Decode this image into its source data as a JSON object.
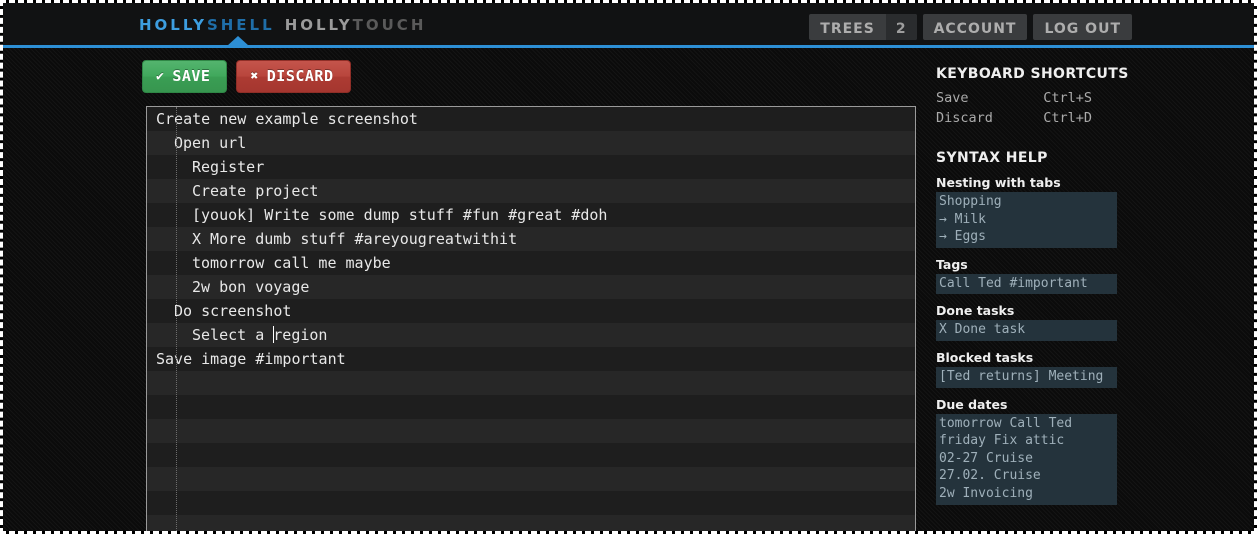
{
  "header": {
    "logo": {
      "part1": "HOLLY",
      "part2": "SHELL",
      "part3": "HOLLY",
      "part4": "TOUCH"
    },
    "accent_color": "#2d8fd5",
    "nav": [
      {
        "label": "TREES",
        "badge": "2"
      },
      {
        "label": "ACCOUNT",
        "badge": ""
      },
      {
        "label": "LOG OUT",
        "badge": ""
      }
    ]
  },
  "toolbar": {
    "save_label": "SAVE",
    "save_icon": "✔",
    "save_color": "#3da85a",
    "discard_label": "DISCARD",
    "discard_icon": "✖",
    "discard_color": "#b8453c"
  },
  "editor": {
    "lines": [
      {
        "text": "Create new example screenshot",
        "indent": 0
      },
      {
        "text": "Open url",
        "indent": 1
      },
      {
        "text": "Register",
        "indent": 2
      },
      {
        "text": "Create project",
        "indent": 2
      },
      {
        "text": "[youok] Write some dump stuff #fun #great #doh",
        "indent": 2
      },
      {
        "text": "X More dumb stuff #areyougreatwithit",
        "indent": 2
      },
      {
        "text": "tomorrow call me maybe",
        "indent": 2
      },
      {
        "text": "2w bon voyage",
        "indent": 2
      },
      {
        "text": "Do screenshot",
        "indent": 1
      },
      {
        "text": "Select a region",
        "indent": 2,
        "caret_after": "Select a "
      },
      {
        "text": "Save image #important",
        "indent": 0
      }
    ],
    "empty_lines": 7
  },
  "sidebar": {
    "shortcuts_title": "KEYBOARD SHORTCUTS",
    "shortcuts": [
      {
        "action": "Save",
        "keys": "Ctrl+S"
      },
      {
        "action": "Discard",
        "keys": "Ctrl+D"
      }
    ],
    "syntax_title": "SYNTAX HELP",
    "syntax_sections": [
      {
        "title": "Nesting with tabs",
        "example": "Shopping\n→ Milk\n→ Eggs"
      },
      {
        "title": "Tags",
        "example": "Call Ted #important"
      },
      {
        "title": "Done tasks",
        "example": "X Done task"
      },
      {
        "title": "Blocked tasks",
        "example": "[Ted returns] Meeting"
      },
      {
        "title": "Due dates",
        "example": "tomorrow Call Ted\nfriday Fix attic\n02-27 Cruise\n27.02. Cruise\n2w Invoicing"
      }
    ],
    "example_bg": "#24333c"
  }
}
